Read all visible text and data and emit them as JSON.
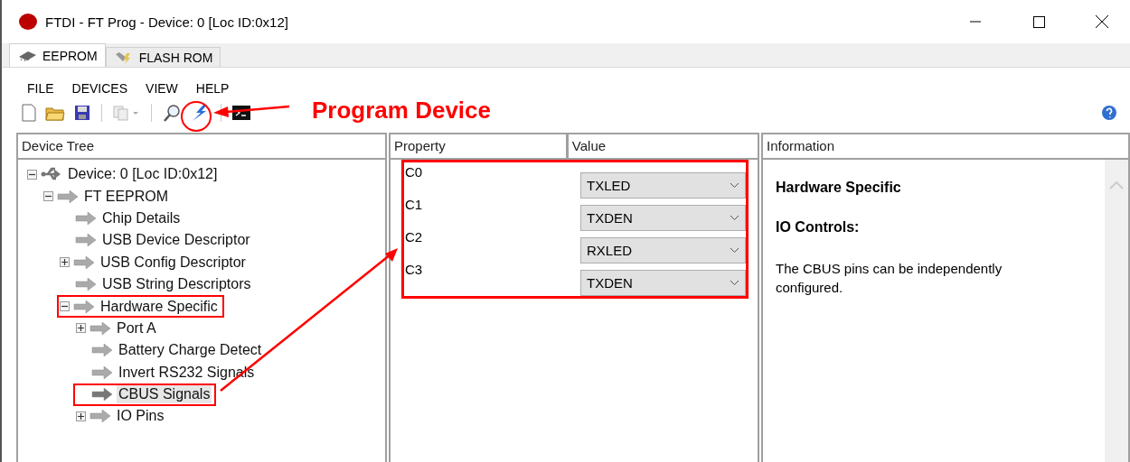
{
  "window": {
    "title": "FTDI - FT Prog - Device: 0 [Loc ID:0x12]"
  },
  "tabs": [
    {
      "label": "EEPROM",
      "selected": true
    },
    {
      "label": "FLASH ROM",
      "selected": false
    }
  ],
  "menu": [
    "FILE",
    "DEVICES",
    "VIEW",
    "HELP"
  ],
  "annotation": {
    "label": "Program Device"
  },
  "device_tree": {
    "title": "Device Tree",
    "items": [
      {
        "label": "Device: 0 [Loc ID:0x12]",
        "kind": "usb",
        "expanded": true,
        "selected": false,
        "highlighted": false,
        "children": [
          {
            "label": "FT EEPROM",
            "kind": "arrow",
            "expanded": true,
            "selected": false,
            "highlighted": false,
            "children": [
              {
                "label": "Chip Details",
                "kind": "arrow",
                "selected": false,
                "highlighted": false
              },
              {
                "label": "USB Device Descriptor",
                "kind": "arrow",
                "selected": false,
                "highlighted": false
              },
              {
                "label": "USB Config Descriptor",
                "kind": "arrow",
                "expanded": false,
                "selected": false,
                "highlighted": false
              },
              {
                "label": "USB String Descriptors",
                "kind": "arrow",
                "selected": false,
                "highlighted": false
              },
              {
                "label": "Hardware Specific",
                "kind": "arrow",
                "expanded": true,
                "selected": false,
                "highlighted": true,
                "children": [
                  {
                    "label": "Port A",
                    "kind": "arrow",
                    "expanded": false,
                    "selected": false,
                    "highlighted": false
                  },
                  {
                    "label": "Battery Charge Detect",
                    "kind": "arrow",
                    "selected": false,
                    "highlighted": false
                  },
                  {
                    "label": "Invert RS232 Signals",
                    "kind": "arrow",
                    "selected": false,
                    "highlighted": false
                  },
                  {
                    "label": "CBUS Signals",
                    "kind": "arrow",
                    "selected": true,
                    "highlighted": true
                  },
                  {
                    "label": "IO Pins",
                    "kind": "arrow",
                    "expanded": false,
                    "selected": false,
                    "highlighted": false
                  }
                ]
              }
            ]
          }
        ]
      }
    ]
  },
  "properties": {
    "columns": [
      "Property",
      "Value"
    ],
    "highlighted": true,
    "rows": [
      {
        "name": "C0",
        "value": "TXLED"
      },
      {
        "name": "C1",
        "value": "TXDEN"
      },
      {
        "name": "C2",
        "value": "RXLED"
      },
      {
        "name": "C3",
        "value": "TXDEN"
      }
    ]
  },
  "information": {
    "title": "Information",
    "heading": "Hardware Specific",
    "subheading": "IO Controls:",
    "text": "The CBUS pins can be independently configured."
  }
}
